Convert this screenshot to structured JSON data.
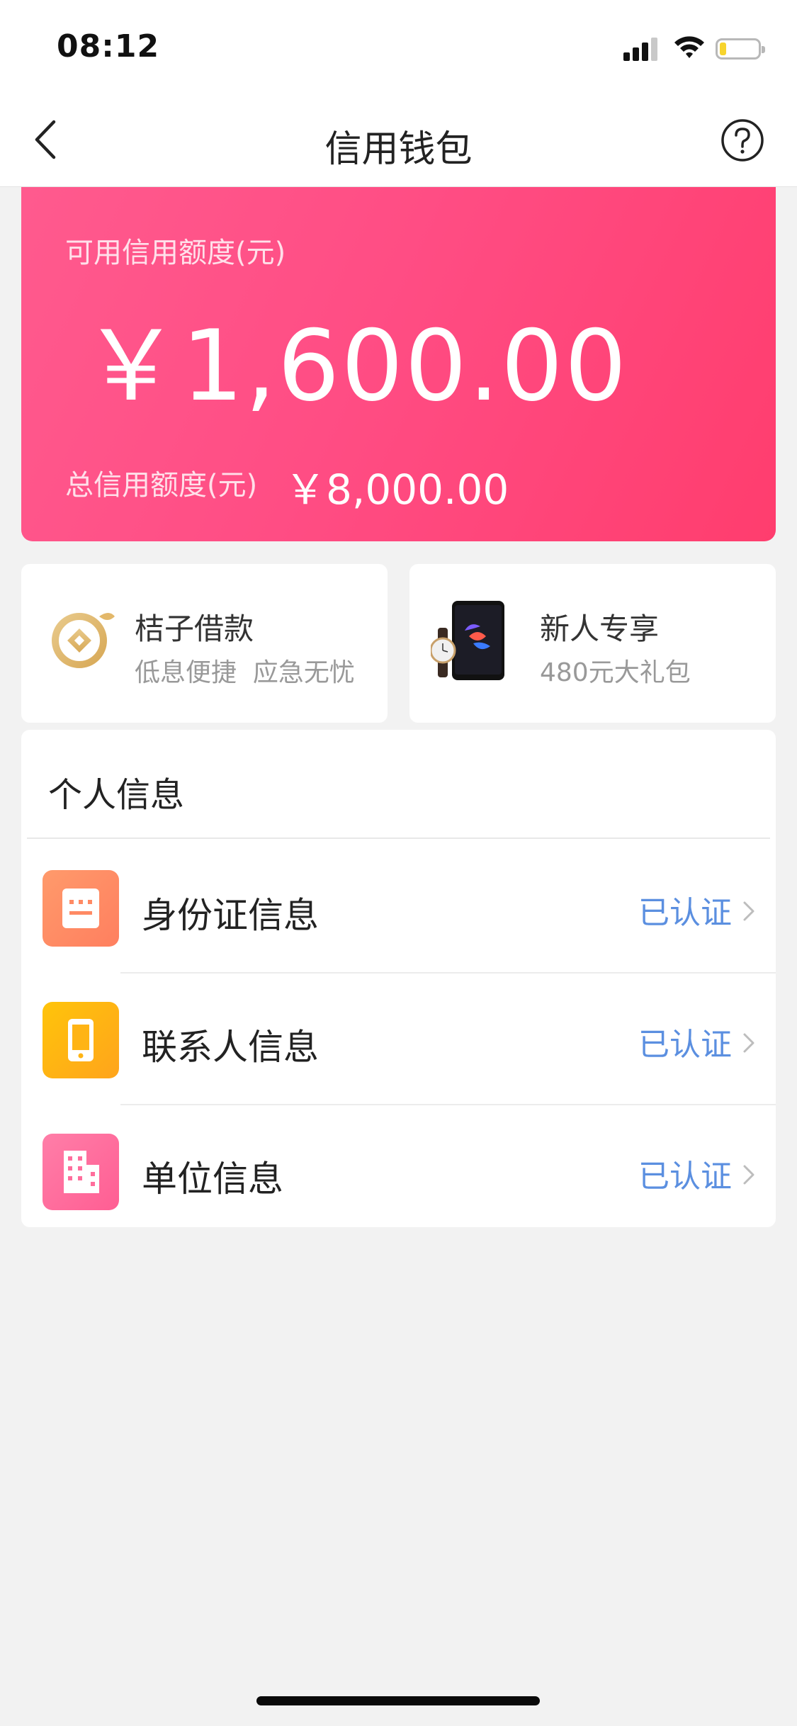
{
  "status_bar": {
    "time": "08:12"
  },
  "nav": {
    "title": "信用钱包"
  },
  "credit": {
    "available_label": "可用信用额度(元)",
    "available_value": "￥1,600.00",
    "total_label": "总信用额度(元)",
    "total_value": "￥8,000.00"
  },
  "promos": [
    {
      "title": "桔子借款",
      "subtitle": "低息便捷  应急无忧",
      "icon": "orange-coin-icon"
    },
    {
      "title": "新人专享",
      "subtitle": "480元大礼包",
      "icon": "phone-watch-icon"
    }
  ],
  "personal_info": {
    "title": "个人信息",
    "items": [
      {
        "label": "身份证信息",
        "status": "已认证",
        "icon": "id-card-icon",
        "color": "#ff8a64"
      },
      {
        "label": "联系人信息",
        "status": "已认证",
        "icon": "phone-icon",
        "color": "#ffb414"
      },
      {
        "label": "单位信息",
        "status": "已认证",
        "icon": "building-icon",
        "color": "#ff6e9c"
      }
    ]
  },
  "colors": {
    "accent": "#ff4d84",
    "status_link": "#5b8fe0",
    "background": "#f2f2f2"
  }
}
